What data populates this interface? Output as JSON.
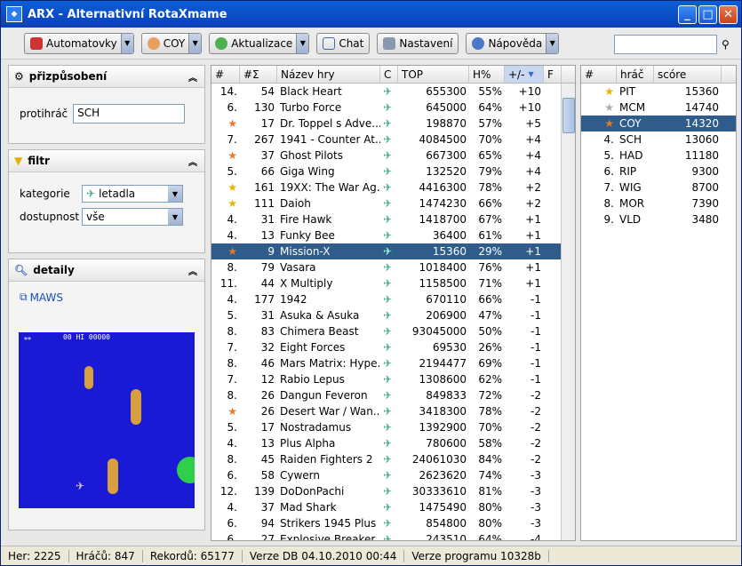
{
  "title": "ARX - Alternativní RotaXmame",
  "toolbar": {
    "automat_label": "Automatovky",
    "player_label": "COY",
    "update_label": "Aktualizace",
    "chat_label": "Chat",
    "settings_label": "Nastavení",
    "help_label": "Nápověda",
    "search_value": ""
  },
  "custom": {
    "title": "přizpůsobení",
    "opponent_label": "protihráč",
    "opponent_value": "SCH"
  },
  "filter": {
    "title": "filtr",
    "category_label": "kategorie",
    "category_value": "letadla",
    "avail_label": "dostupnost",
    "avail_value": "vše"
  },
  "details": {
    "title": "detaily",
    "link": "MAWS",
    "hud": "00 HI 00000",
    "lives": "**"
  },
  "games_table": {
    "headers": [
      "#",
      "#Σ",
      "Název hry",
      "C",
      "TOP",
      "H%",
      "+/-",
      "F"
    ],
    "rows": [
      {
        "rank": "14.",
        "sum": "54",
        "name": "Black Heart",
        "top": "655300",
        "h": "55%",
        "pm": "+10",
        "medal": ""
      },
      {
        "rank": "6.",
        "sum": "130",
        "name": "Turbo Force",
        "top": "645000",
        "h": "64%",
        "pm": "+10",
        "medal": ""
      },
      {
        "rank": "",
        "sum": "17",
        "name": "Dr. Toppel s Adve...",
        "top": "198870",
        "h": "57%",
        "pm": "+5",
        "medal": "bronze"
      },
      {
        "rank": "7.",
        "sum": "267",
        "name": "1941 - Counter At...",
        "top": "4084500",
        "h": "70%",
        "pm": "+4",
        "medal": ""
      },
      {
        "rank": "",
        "sum": "37",
        "name": "Ghost Pilots",
        "top": "667300",
        "h": "65%",
        "pm": "+4",
        "medal": "bronze"
      },
      {
        "rank": "5.",
        "sum": "66",
        "name": "Giga Wing",
        "top": "132520",
        "h": "79%",
        "pm": "+4",
        "medal": ""
      },
      {
        "rank": "",
        "sum": "161",
        "name": "19XX: The War Ag...",
        "top": "4416300",
        "h": "78%",
        "pm": "+2",
        "medal": "gold"
      },
      {
        "rank": "",
        "sum": "111",
        "name": "Daioh",
        "top": "1474230",
        "h": "66%",
        "pm": "+2",
        "medal": "gold"
      },
      {
        "rank": "4.",
        "sum": "31",
        "name": "Fire Hawk",
        "top": "1418700",
        "h": "67%",
        "pm": "+1",
        "medal": ""
      },
      {
        "rank": "4.",
        "sum": "13",
        "name": "Funky Bee",
        "top": "36400",
        "h": "61%",
        "pm": "+1",
        "medal": ""
      },
      {
        "rank": "",
        "sum": "9",
        "name": "Mission-X",
        "top": "15360",
        "h": "29%",
        "pm": "+1",
        "medal": "bronze",
        "selected": true
      },
      {
        "rank": "8.",
        "sum": "79",
        "name": "Vasara",
        "top": "1018400",
        "h": "76%",
        "pm": "+1",
        "medal": ""
      },
      {
        "rank": "11.",
        "sum": "44",
        "name": "X Multiply",
        "top": "1158500",
        "h": "71%",
        "pm": "+1",
        "medal": ""
      },
      {
        "rank": "4.",
        "sum": "177",
        "name": "1942",
        "top": "670110",
        "h": "66%",
        "pm": "-1",
        "medal": ""
      },
      {
        "rank": "5.",
        "sum": "31",
        "name": "Asuka & Asuka",
        "top": "206900",
        "h": "47%",
        "pm": "-1",
        "medal": ""
      },
      {
        "rank": "8.",
        "sum": "83",
        "name": "Chimera Beast",
        "top": "93045000",
        "h": "50%",
        "pm": "-1",
        "medal": ""
      },
      {
        "rank": "7.",
        "sum": "32",
        "name": "Eight Forces",
        "top": "69530",
        "h": "26%",
        "pm": "-1",
        "medal": ""
      },
      {
        "rank": "8.",
        "sum": "46",
        "name": "Mars Matrix: Hype...",
        "top": "2194477",
        "h": "69%",
        "pm": "-1",
        "medal": ""
      },
      {
        "rank": "7.",
        "sum": "12",
        "name": "Rabio Lepus",
        "top": "1308600",
        "h": "62%",
        "pm": "-1",
        "medal": ""
      },
      {
        "rank": "8.",
        "sum": "26",
        "name": "Dangun Feveron",
        "top": "849833",
        "h": "72%",
        "pm": "-2",
        "medal": ""
      },
      {
        "rank": "",
        "sum": "26",
        "name": "Desert War / Wan...",
        "top": "3418300",
        "h": "78%",
        "pm": "-2",
        "medal": "bronze"
      },
      {
        "rank": "5.",
        "sum": "17",
        "name": "Nostradamus",
        "top": "1392900",
        "h": "70%",
        "pm": "-2",
        "medal": ""
      },
      {
        "rank": "4.",
        "sum": "13",
        "name": "Plus Alpha",
        "top": "780600",
        "h": "58%",
        "pm": "-2",
        "medal": ""
      },
      {
        "rank": "8.",
        "sum": "45",
        "name": "Raiden Fighters 2",
        "top": "24061030",
        "h": "84%",
        "pm": "-2",
        "medal": ""
      },
      {
        "rank": "6.",
        "sum": "58",
        "name": "Cywern",
        "top": "2623620",
        "h": "74%",
        "pm": "-3",
        "medal": ""
      },
      {
        "rank": "12.",
        "sum": "139",
        "name": "DoDonPachi",
        "top": "30333610",
        "h": "81%",
        "pm": "-3",
        "medal": ""
      },
      {
        "rank": "4.",
        "sum": "37",
        "name": "Mad Shark",
        "top": "1475490",
        "h": "80%",
        "pm": "-3",
        "medal": ""
      },
      {
        "rank": "6.",
        "sum": "94",
        "name": "Strikers 1945 Plus",
        "top": "854800",
        "h": "80%",
        "pm": "-3",
        "medal": ""
      },
      {
        "rank": "6.",
        "sum": "27",
        "name": "Explosive Breaker",
        "top": "243510",
        "h": "64%",
        "pm": "-4",
        "medal": ""
      }
    ]
  },
  "players_table": {
    "headers": [
      "#",
      "hráč",
      "scóre"
    ],
    "rows": [
      {
        "rank": "",
        "name": "PIT",
        "score": "15360",
        "medal": "gold"
      },
      {
        "rank": "",
        "name": "MCM",
        "score": "14740",
        "medal": "silver"
      },
      {
        "rank": "",
        "name": "COY",
        "score": "14320",
        "medal": "bronze",
        "selected": true
      },
      {
        "rank": "4.",
        "name": "SCH",
        "score": "13060",
        "medal": ""
      },
      {
        "rank": "5.",
        "name": "HAD",
        "score": "11180",
        "medal": ""
      },
      {
        "rank": "6.",
        "name": "RIP",
        "score": "9300",
        "medal": ""
      },
      {
        "rank": "7.",
        "name": "WIG",
        "score": "8700",
        "medal": ""
      },
      {
        "rank": "8.",
        "name": "MOR",
        "score": "7390",
        "medal": ""
      },
      {
        "rank": "9.",
        "name": "VLD",
        "score": "3480",
        "medal": ""
      }
    ]
  },
  "status": {
    "games": "Her: 2225",
    "players": "Hráčů: 847",
    "records": "Rekordů: 65177",
    "db": "Verze DB 04.10.2010 00:44",
    "program": "Verze programu 10328b"
  },
  "colors": {
    "selection": "#2f5c8a",
    "titlebar": "#0a5fd8"
  }
}
